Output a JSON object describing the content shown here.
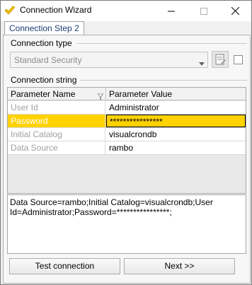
{
  "window": {
    "title": "Connection Wizard",
    "icon": "checkmark-logo-icon",
    "controls": [
      "minimize-icon",
      "maximize-icon",
      "close-icon"
    ]
  },
  "tabs": [
    {
      "label": "Connection Step 2",
      "active": true
    }
  ],
  "connection_type": {
    "group_label": "Connection type",
    "selected": "Standard Security"
  },
  "connection_string": {
    "group_label": "Connection string",
    "columns": [
      "Parameter Name",
      "Parameter Value"
    ],
    "rows": [
      {
        "name": "User Id",
        "value": "Administrator",
        "selected": false
      },
      {
        "name": "Password",
        "value": "****************",
        "selected": true
      },
      {
        "name": "Initial Catalog",
        "value": "visualcrondb",
        "selected": false
      },
      {
        "name": "Data Source",
        "value": "rambo",
        "selected": false
      }
    ],
    "text": "Data Source=rambo;Initial Catalog=visualcrondb;User Id=Administrator;Password=****************;"
  },
  "buttons": {
    "test": "Test connection",
    "next": "Next >>"
  },
  "colors": {
    "selected_row": "#ffd200",
    "tab_text": "#1e3c73"
  }
}
